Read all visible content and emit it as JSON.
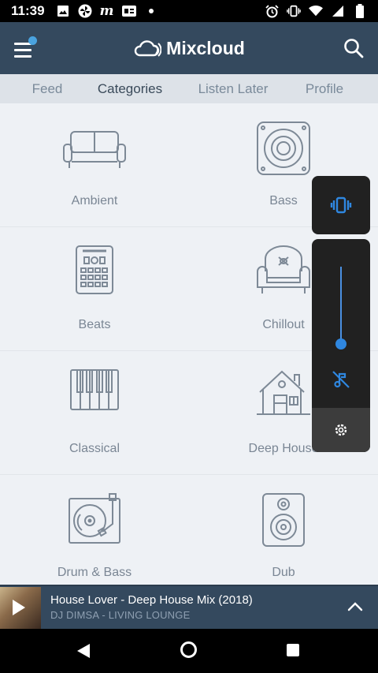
{
  "status_bar": {
    "time": "11:39",
    "notification_icons": [
      "image-icon",
      "pinwheel-icon",
      "m-icon",
      "ge-icon",
      "dot-icon"
    ],
    "system_icons": [
      "alarm-icon",
      "vibrate-icon",
      "wifi-icon",
      "signal-icon",
      "battery-icon"
    ]
  },
  "app_bar": {
    "brand": "Mixcloud",
    "menu_has_badge": true,
    "badge_color": "#4aa3df",
    "background": "#34495e"
  },
  "tabs": [
    {
      "label": "Feed",
      "active": false
    },
    {
      "label": "Categories",
      "active": true
    },
    {
      "label": "Listen Later",
      "active": false
    },
    {
      "label": "Profile",
      "active": false
    }
  ],
  "categories": [
    {
      "label": "Ambient",
      "icon": "sofa-icon"
    },
    {
      "label": "Bass",
      "icon": "speaker-icon"
    },
    {
      "label": "Beats",
      "icon": "drum-machine-icon"
    },
    {
      "label": "Chillout",
      "icon": "armchair-icon"
    },
    {
      "label": "Classical",
      "icon": "piano-keys-icon"
    },
    {
      "label": "Deep House",
      "icon": "house-icon"
    },
    {
      "label": "Drum & Bass",
      "icon": "turntable-icon"
    },
    {
      "label": "Dub",
      "icon": "speaker-cabinet-icon"
    }
  ],
  "volume_overlay": {
    "ringer_mode": "vibrate-icon",
    "level_fraction": 0.1,
    "media_muted_icon": "music-off-icon",
    "settings_icon": "gear-icon",
    "accent": "#2f87e0"
  },
  "mini_player": {
    "title": "House Lover - Deep House Mix (2018)",
    "subtitle": "DJ DIMSA - LIVING LOUNGE",
    "expand_icon": "chevron-up-icon",
    "play_icon": "play-icon"
  },
  "nav_bar": {
    "buttons": [
      "back-icon",
      "home-icon",
      "recents-icon"
    ]
  }
}
